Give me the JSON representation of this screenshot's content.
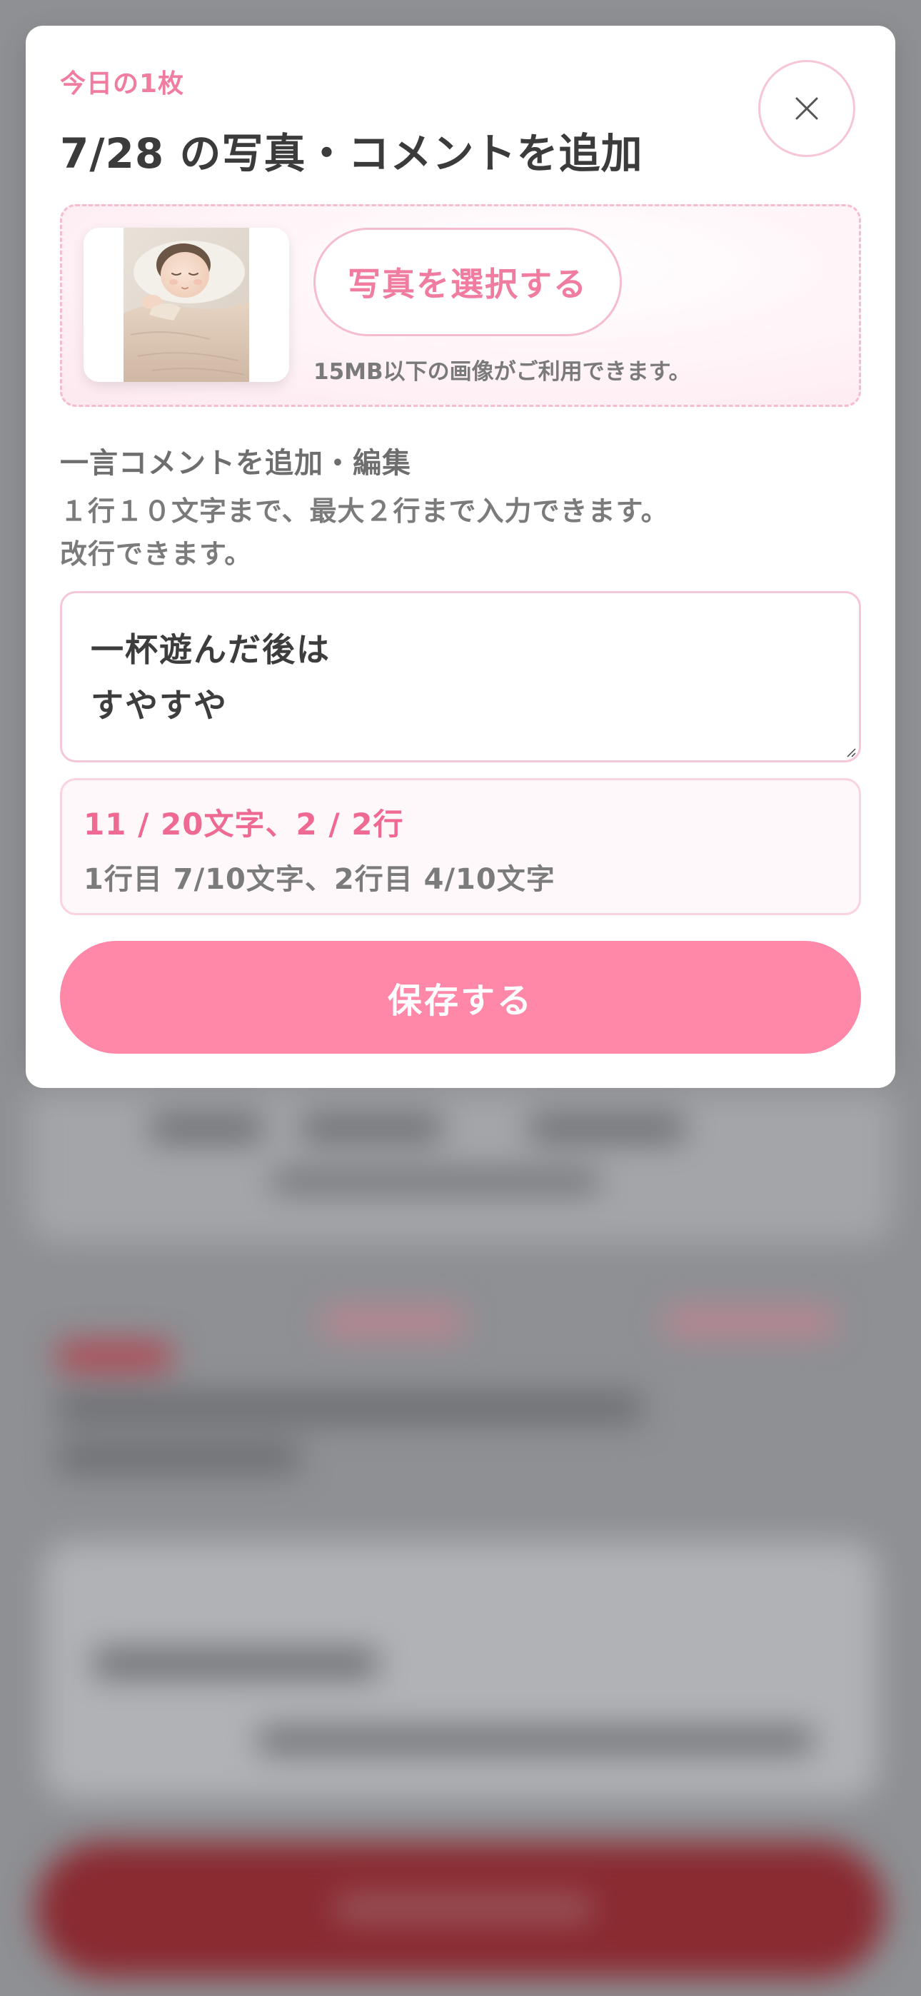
{
  "modal": {
    "eyebrow": "今日の1枚",
    "title": "7/28 の写真・コメントを追加",
    "close_icon": "close-icon"
  },
  "photo": {
    "thumbnail_alt": "眠っている赤ちゃんの写真",
    "select_label": "写真を選択する",
    "size_note": "15MB以下の画像がご利用できます。"
  },
  "comment": {
    "heading": "一言コメントを追加・編集",
    "help_line1": "１行１０文字まで、最大２行まで入力できます。",
    "help_line2": "改行できます。",
    "value_line1": "一杯遊んだ後は",
    "value_line2": "すやすや"
  },
  "counter": {
    "total": "11 / 20文字、2 / 2行",
    "per_line": "1行目 7/10文字、2行目 4/10文字"
  },
  "actions": {
    "save_label": "保存する"
  },
  "colors": {
    "accent": "#f07c9f",
    "save_button": "#ff87a8",
    "overlay": "#8e9094"
  }
}
